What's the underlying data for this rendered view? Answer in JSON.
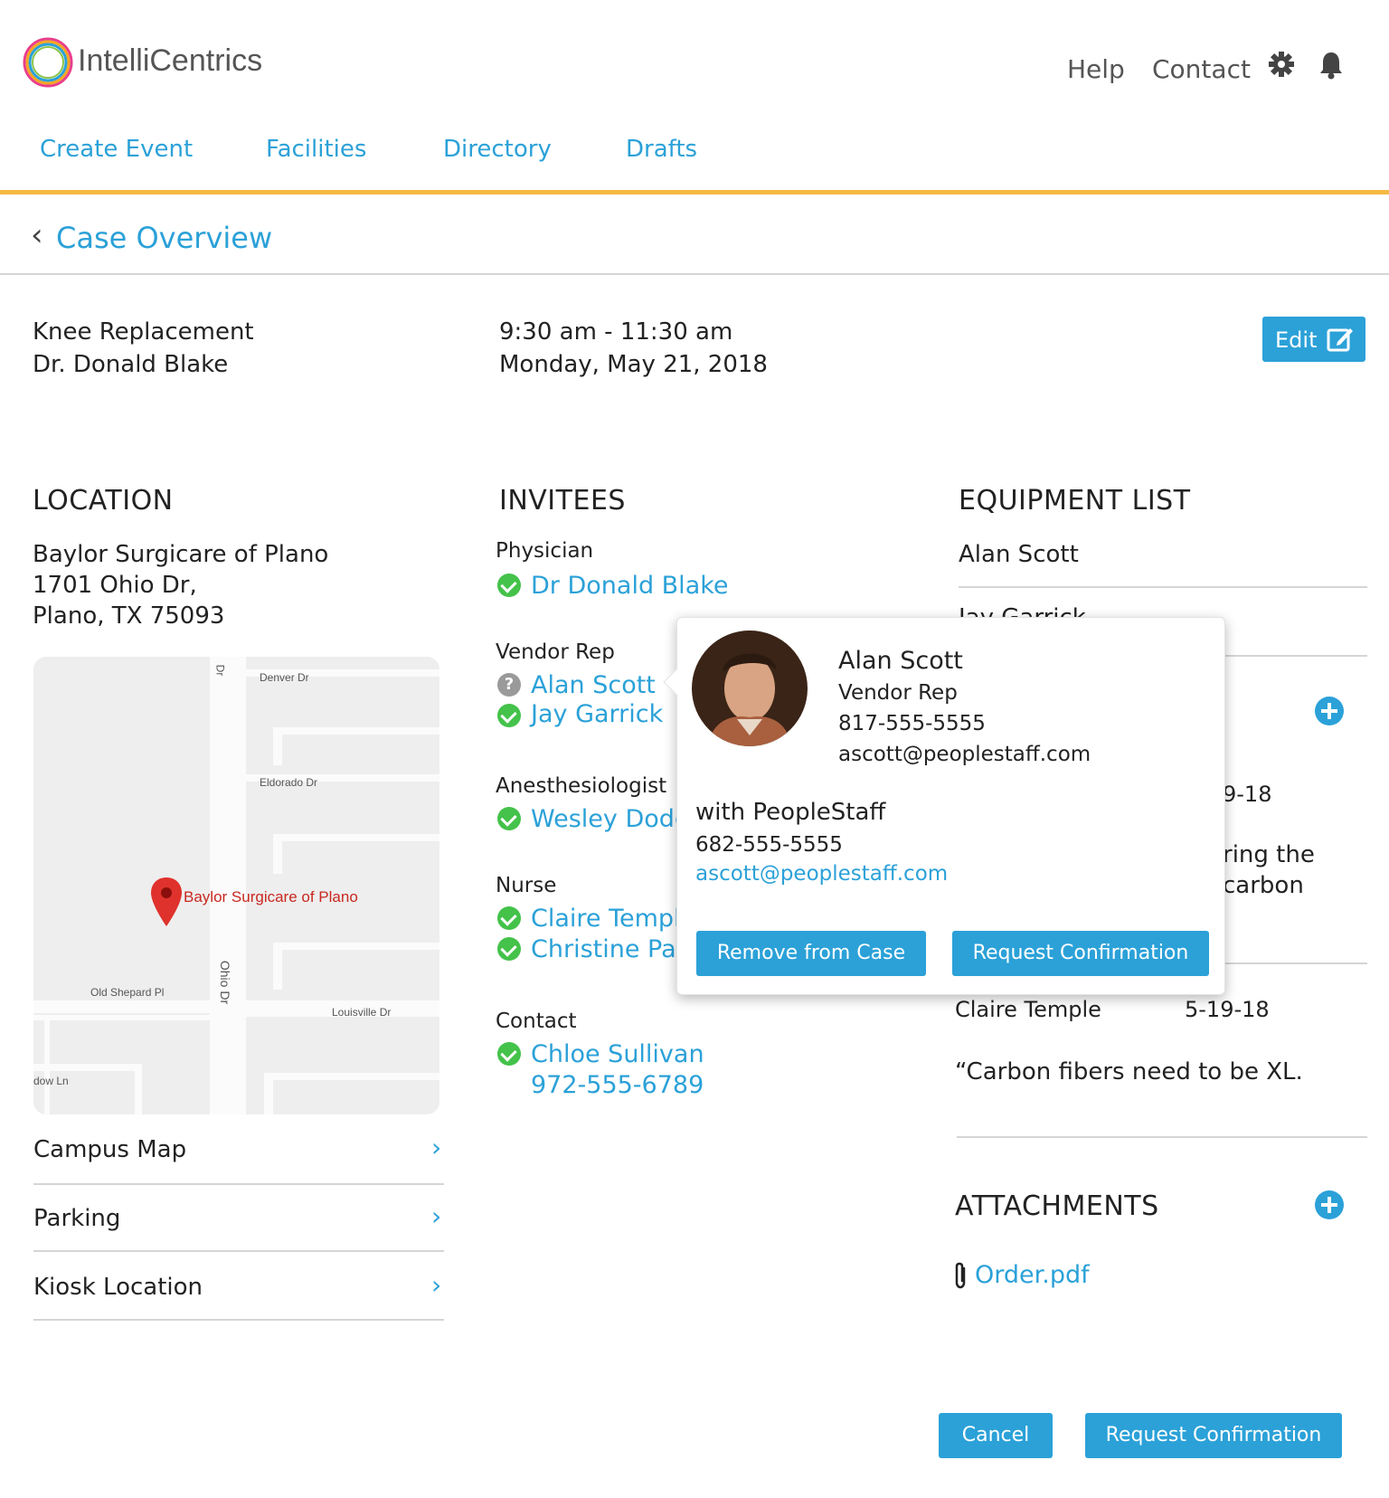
{
  "header": {
    "brand": "IntelliCentrics",
    "help": "Help",
    "contact": "Contact"
  },
  "tabs": [
    "Create Event",
    "Facilities",
    "Directory",
    "Drafts"
  ],
  "page_title": "Case Overview",
  "case": {
    "procedure": "Knee Replacement",
    "doctor": "Dr. Donald Blake",
    "time": "9:30 am - 11:30 am",
    "date": "Monday, May 21, 2018",
    "edit_label": "Edit"
  },
  "location": {
    "title": "LOCATION",
    "name": "Baylor Surgicare of Plano",
    "address1": "1701 Ohio Dr,",
    "address2": "Plano, TX 75093",
    "map": {
      "pin_label": "Baylor Surgicare of Plano",
      "streets": [
        "Denver Dr",
        "Eldorado Dr",
        "Old Shepard Pl",
        "Louisville Dr",
        "Ohio Dr",
        "Dr",
        "dow Ln"
      ]
    },
    "links": [
      "Campus Map",
      "Parking",
      "Kiosk Location"
    ]
  },
  "invitees": {
    "title": "INVITEES",
    "physician_label": "Physician",
    "physician": "Dr Donald Blake",
    "vendor_label": "Vendor Rep",
    "vendor1": "Alan Scott",
    "vendor2": "Jay Garrick",
    "anesthesiologist_label": "Anesthesiologist",
    "anesthesiologist": "Wesley Dodd",
    "nurse_label": "Nurse",
    "nurse1": "Claire Temple",
    "nurse2": "Christine Palmer",
    "contact_label": "Contact",
    "contact_name": "Chloe Sullivan",
    "contact_phone": "972-555-6789"
  },
  "equipment": {
    "title": "EQUIPMENT LIST",
    "row1": "Alan Scott",
    "row2": "Jay Garrick",
    "partial_date": "9-18",
    "partial_note1": "ring the",
    "partial_note2": "carbon",
    "note_author": "Claire Temple",
    "note_date": "5-19-18",
    "note_text": "“Carbon fibers need to be XL."
  },
  "attachments": {
    "title": "ATTACHMENTS",
    "file": "Order.pdf"
  },
  "popover": {
    "name": "Alan Scott",
    "role": "Vendor Rep",
    "phone": "817-555-5555",
    "email": "ascott@peoplestaff.com",
    "company": "with PeopleStaff",
    "company_phone": "682-555-5555",
    "company_email": "ascott@peoplestaff.com",
    "remove_label": "Remove from Case",
    "confirm_label": "Request Confirmation"
  },
  "footer": {
    "cancel": "Cancel",
    "request": "Request Confirmation"
  },
  "colors": {
    "accent": "#2ba1d8",
    "tab_underline": "#f5b942",
    "confirmed": "#44c24a",
    "pending": "#9a9a9a"
  }
}
